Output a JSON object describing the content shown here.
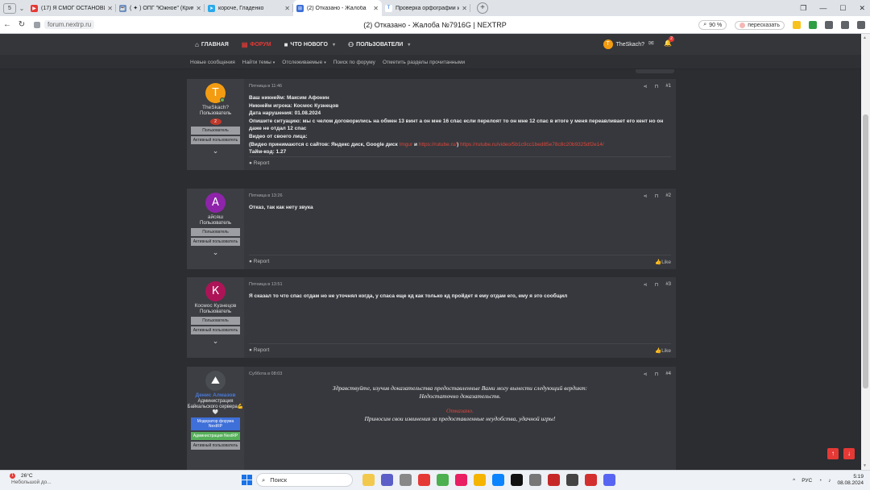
{
  "browser": {
    "tab_count": "5",
    "tabs": [
      {
        "title": "(17) Я СМОГ ОСТАНОВИ",
        "color": "#e53935",
        "glyph": "▶",
        "active": false
      },
      {
        "title": "( ✦ ) ОПГ \"Южное\" (Крим",
        "color": "#6c8ebf",
        "glyph": "☕",
        "active": false
      },
      {
        "title": "короче, Гладенко",
        "color": "#29a9eb",
        "glyph": "➤",
        "active": false
      },
      {
        "title": "(2) Отказано - Жалоба",
        "color": "#3b6fd8",
        "glyph": "⊞",
        "active": true
      },
      {
        "title": "Проверка орфографии и",
        "color": "#ffffff",
        "glyph": "T",
        "active": false
      }
    ],
    "url": "forum.nextrp.ru",
    "page_title": "(2) Отказано - Жалоба №7916G | NEXTRP",
    "zoom": "90 %",
    "translate": "пересказать"
  },
  "forum_nav": {
    "items": [
      {
        "label": "ГЛАВНАЯ",
        "icon": "home-icon",
        "glyph": "⌂",
        "active": false,
        "caret": false
      },
      {
        "label": "ФОРУМ",
        "icon": "forum-icon",
        "glyph": "▤",
        "active": true,
        "caret": false
      },
      {
        "label": "ЧТО НОВОГО",
        "icon": "news-icon",
        "glyph": "■",
        "active": false,
        "caret": true
      },
      {
        "label": "ПОЛЬЗОВАТЕЛИ",
        "icon": "users-icon",
        "glyph": "⚇",
        "active": false,
        "caret": true
      }
    ],
    "user": "TheSkach?",
    "user_initial": "T",
    "alerts_count": "2"
  },
  "sub_nav": {
    "items": [
      {
        "label": "Новые сообщения",
        "caret": false
      },
      {
        "label": "Найти темы",
        "caret": true
      },
      {
        "label": "Отслеживаемые",
        "caret": true
      },
      {
        "label": "Поиск по форуму",
        "caret": false
      },
      {
        "label": "Отметить разделы прочитанными",
        "caret": false
      }
    ]
  },
  "posts": [
    {
      "author": "TheSkach?",
      "initial": "T",
      "avatar_color": "#f39c12",
      "title": "Пользователь",
      "badge": "2",
      "banners": [
        "Пользователь",
        "Активный пользователь"
      ],
      "time": "Пятница в 11:46",
      "number": "#1",
      "lines": [
        "Ваш никнейм: Максим Афонин",
        "Никнейм игрока: Космос Кузнецов",
        "Дата нарушения: 01.08.2024",
        "Опишите ситуацию: мы с челом договорились на обмен 13 винт а он мне 16 спас если перелоят то он мне 12 спас в итоге у меня переавливает его кент но он даже не отдал 12 спас",
        "Видео от своего лица:"
      ],
      "video_prefix": "(Видео принимаются с сайтов: Яндекс диск, Google диск",
      "video_link1": "Imgur",
      "video_and": "и",
      "video_link2": "https://rutube.ru/",
      "video_close": ")",
      "video_link3": "https://rutube.ru/video/5b1c9cc1bed85e78c8c20b9325df2e14/",
      "timecode": "Тайм-код: 1.27",
      "report": "Report",
      "like": ""
    },
    {
      "author": "айсяш",
      "initial": "А",
      "avatar_color": "#8e24aa",
      "title": "Пользователь",
      "banners": [
        "Пользователь",
        "Активный пользователь"
      ],
      "time": "Пятница в 13:26",
      "number": "#2",
      "text": "Отказ, так как нету звука",
      "report": "Report",
      "like": "Like"
    },
    {
      "author": "Космос Кузнецов",
      "initial": "К",
      "avatar_color": "#ad1457",
      "title": "Пользователь",
      "banners": [
        "Пользователь",
        "Активный пользователь"
      ],
      "time": "Пятница в 13:51",
      "number": "#3",
      "text": "Я сказал то что спас отдам но не уточнял когда, у спаса еще кд как только кд пройдет я ему отдам его, ему я это сообщил",
      "report": "Report",
      "like": "Like"
    },
    {
      "author": "Денис Алмазов",
      "avatar_color": "#4a4d52",
      "title": "Администрация Байкальского сервера💪🤍",
      "banners": [
        "Модератор форума NextRP",
        "Администрация NextRP",
        "Активный пользователь"
      ],
      "time": "Суббота в 08:03",
      "number": "#4",
      "verdict_1": "Здравствуйте, изучив доказательства предоставленные Вами могу вынести следующий вердикт:",
      "verdict_2": "Недостаточно доказательств.",
      "verdict_3": "Отказано.",
      "verdict_4": "Приносим свои извинения за предоставленные неудобства, удачной игры!"
    }
  ],
  "taskbar": {
    "weather_temp": "26°C",
    "weather_desc": "Небольшой до...",
    "weather_badge": "1",
    "search_label": "Поиск",
    "lang": "РУС",
    "time": "5:19",
    "date": "08.08.2024"
  }
}
